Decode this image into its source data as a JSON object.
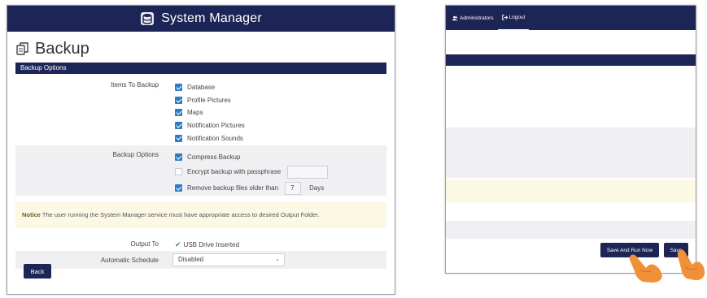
{
  "app": {
    "title": "System Manager"
  },
  "page": {
    "heading": "Backup"
  },
  "backup_options_section": {
    "title": "Backup Options"
  },
  "items_to_backup": {
    "label": "Items To Backup",
    "items": [
      {
        "label": "Database",
        "checked": true
      },
      {
        "label": "Profile Pictures",
        "checked": true
      },
      {
        "label": "Maps",
        "checked": true
      },
      {
        "label": "Notification Pictures",
        "checked": true
      },
      {
        "label": "Notification Sounds",
        "checked": true
      }
    ]
  },
  "backup_options": {
    "label": "Backup Options",
    "compress": {
      "label": "Compress Backup",
      "checked": true
    },
    "encrypt": {
      "label": "Encrypt backup with passphrase",
      "checked": false,
      "value": ""
    },
    "remove_old": {
      "label_before": "Remove backup files older than",
      "value": "7",
      "label_after": "Days",
      "checked": true
    }
  },
  "notice": {
    "prefix": "Notice",
    "text": " The user running the System Manager service must have appropriate access to desired Output Folder."
  },
  "output_to": {
    "label": "Output To",
    "value": "USB Drive Inserted"
  },
  "automatic_schedule": {
    "label": "Automatic Schedule",
    "selected": "Disabled"
  },
  "buttons": {
    "back": "Back",
    "save_and_run_now": "Save And Run Now",
    "save": "Save"
  },
  "right_nav": {
    "administrators": "Administrators",
    "logout": "Logout"
  },
  "colors": {
    "navy": "#1c2556",
    "checkbox_blue": "#2c7bc6",
    "notice_bg": "#fbf8e3",
    "hand_orange": "#f0913a"
  }
}
